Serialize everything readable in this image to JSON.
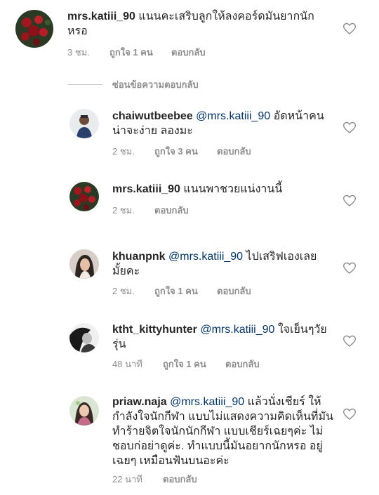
{
  "hide_replies_label": "ซ่อนข้อความตอบกลับ",
  "comments": [
    {
      "username": "mrs.katiii_90",
      "mention": "",
      "text_line1": "แนนคะเสริบลูกให้ลงคอร์ดมันยากนัก",
      "text_line2": "หรอ",
      "time": "3 ชม.",
      "likes": "ถูกใจ 1 คน",
      "reply": "ตอบกลับ",
      "avatar": "roses-avatar"
    },
    {
      "username": "chaiwutbeebee",
      "mention": "@mrs.katiii_90",
      "text_line1": "อัดหน้าคน",
      "text_line2": "น่าจะง่าย ลองมะ",
      "time": "2 ชม.",
      "likes": "ถูกใจ 3 คน",
      "reply": "ตอบกลับ",
      "avatar": "man-avatar"
    },
    {
      "username": "mrs.katiii_90",
      "mention": "",
      "text_line1": "แนนพาชวยแน่งานนี้",
      "text_line2": "",
      "time": "2 ชม.",
      "likes": "",
      "reply": "ตอบกลับ",
      "avatar": "roses-avatar"
    },
    {
      "username": "khuanpnk",
      "mention": "@mrs.katiii_90",
      "text_line1": "ไปเสริฟเองเลย",
      "text_line2": "มั้ยคะ",
      "time": "2 ชม.",
      "likes": "ถูกใจ 1 คน",
      "reply": "ตอบกลับ",
      "avatar": "woman-avatar"
    },
    {
      "username": "ktht_kittyhunter",
      "mention": "@mrs.katiii_90",
      "text_line1": "ใจเย็นๆวัย",
      "text_line2": "รุ่น",
      "time": "48 นาที",
      "likes": "ถูกใจ 1 คน",
      "reply": "ตอบกลับ",
      "avatar": "bw-avatar"
    },
    {
      "username": "priaw.naja",
      "mention": "@mrs.katiii_90",
      "text_line1": "แล้วนั่งเชียร์ ให้",
      "text_line2": "กำลังใจนักกีฬา แบบไม่แสดงความคิดเห็นที่มัน",
      "text_line3": "ทำร้ายจิตใจนักนักกีฬา  แบบเชียร์เฉยๆค่ะ ไม่",
      "text_line4": "ชอบก่อย่าดูค่ะ. ทำแบบนี้มันอยากนักหรอ อยู่",
      "text_line5": "เฉยๆ เหมือนฟันบนอะค่ะ",
      "time": "22 นาที",
      "likes": "",
      "reply": "ตอบกลับ",
      "avatar": "girl-avatar"
    }
  ],
  "icons": {
    "like": "heart-outline-icon"
  }
}
